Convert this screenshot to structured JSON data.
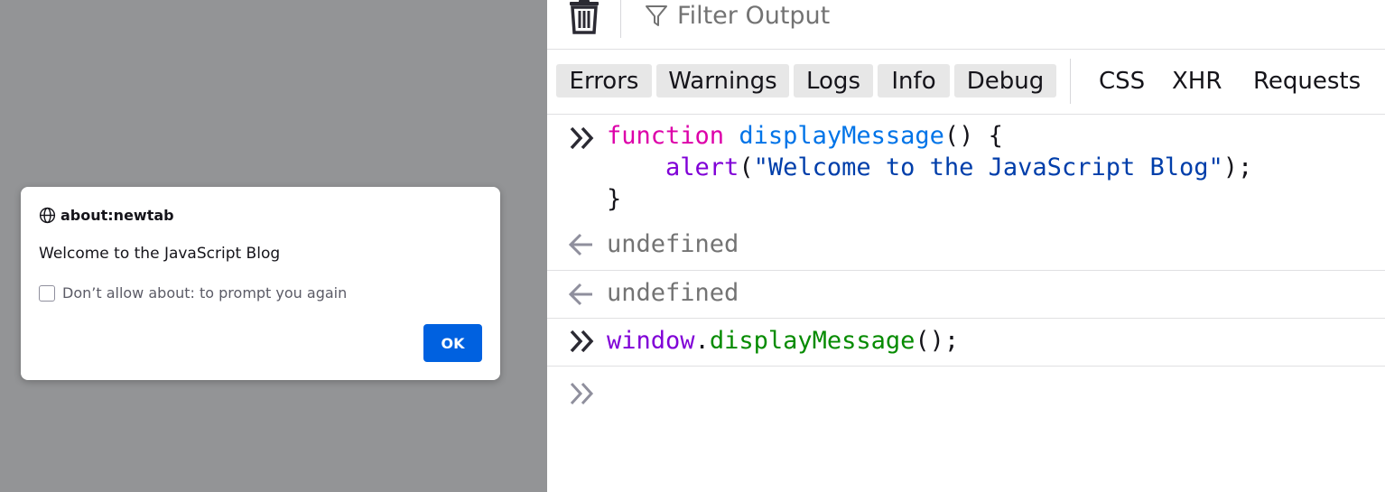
{
  "dialog": {
    "origin": "about:newtab",
    "message": "Welcome to the JavaScript Blog",
    "checkbox_label": "Don’t allow about: to prompt you again",
    "ok_label": "OK"
  },
  "toolbar": {
    "filter_placeholder": "Filter Output"
  },
  "filters": {
    "chips": [
      "Errors",
      "Warnings",
      "Logs",
      "Info",
      "Debug"
    ],
    "plain": [
      "CSS",
      "XHR",
      "Requests"
    ]
  },
  "console": {
    "input1": {
      "keyword": "function",
      "name": "displayMessage",
      "paren_open": "() {",
      "indent": "    ",
      "alert": "alert",
      "alert_open": "(",
      "string": "\"Welcome to the JavaScript Blog\"",
      "alert_close": ");",
      "close_brace": "}"
    },
    "result1": "undefined",
    "result2": "undefined",
    "input2": {
      "object": "window",
      "dot": ".",
      "method": "displayMessage",
      "tail": "();"
    }
  },
  "colors": {
    "ok_button": "#0061e0",
    "keyword": "#dd00a9",
    "function_name": "#0074e8",
    "string": "#003eaa",
    "window": "#8000d7",
    "method": "#058b00"
  }
}
